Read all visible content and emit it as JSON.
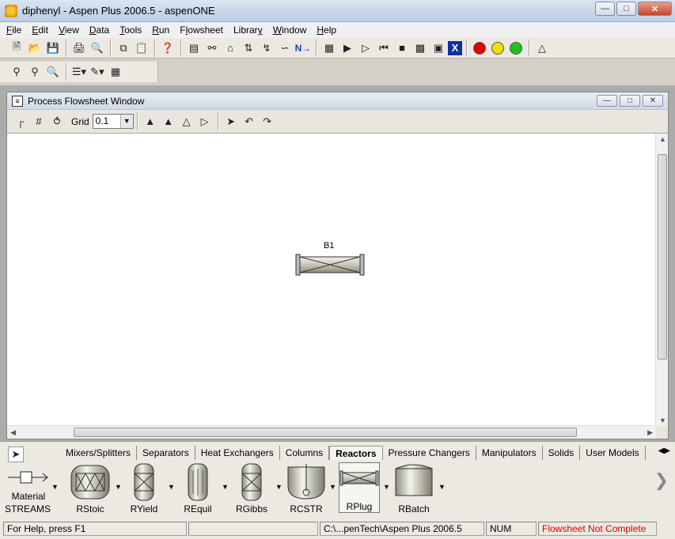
{
  "window": {
    "title": "diphenyl - Aspen Plus 2006.5 - aspenONE",
    "controls": [
      "minimize",
      "maximize",
      "close"
    ]
  },
  "menu": [
    {
      "label": "File",
      "key": "F"
    },
    {
      "label": "Edit",
      "key": "E"
    },
    {
      "label": "View",
      "key": "V"
    },
    {
      "label": "Data",
      "key": "D"
    },
    {
      "label": "Tools",
      "key": "T"
    },
    {
      "label": "Run",
      "key": "R"
    },
    {
      "label": "Flowsheet",
      "key": "l"
    },
    {
      "label": "Library",
      "key": "y"
    },
    {
      "label": "Window",
      "key": "W"
    },
    {
      "label": "Help",
      "key": "H"
    }
  ],
  "flowsheet_window": {
    "title": "Process Flowsheet Window",
    "grid_label": "Grid",
    "grid_value": "0.1",
    "block": {
      "name": "B1"
    }
  },
  "palette": {
    "tabs": [
      "Mixers/Splitters",
      "Separators",
      "Heat Exchangers",
      "Columns",
      "Reactors",
      "Pressure Changers",
      "Manipulators",
      "Solids",
      "User Models"
    ],
    "active_tab": "Reactors",
    "stream_label_1": "Material",
    "stream_label_2": "STREAMS",
    "models": [
      "RStoic",
      "RYield",
      "REquil",
      "RGibbs",
      "RCSTR",
      "RPlug",
      "RBatch"
    ]
  },
  "status": {
    "help": "For Help, press F1",
    "path": "C:\\...penTech\\Aspen Plus 2006.5",
    "num": "NUM",
    "message": "Flowsheet Not Complete",
    "message_color": "#e00000"
  }
}
